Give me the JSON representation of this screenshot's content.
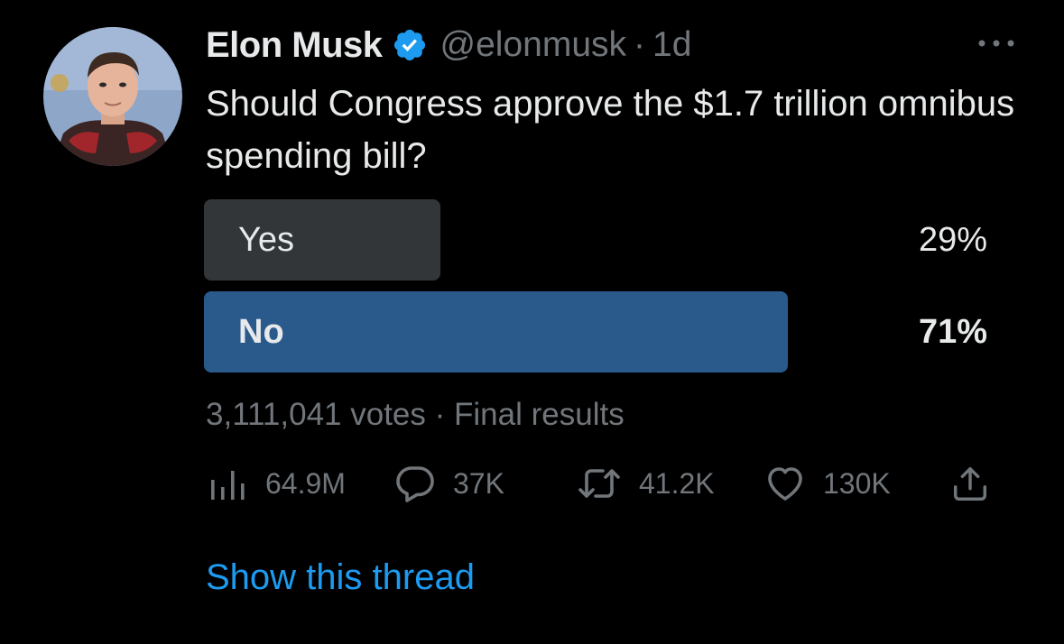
{
  "tweet": {
    "author_name": "Elon Musk",
    "handle": "@elonmusk",
    "separator": "·",
    "time": "1d",
    "verified": true,
    "text": "Should Congress approve the $1.7 trillion omnibus spending bill?"
  },
  "poll": {
    "options": [
      {
        "label": "Yes",
        "percent_text": "29%",
        "fraction": 0.29,
        "winner": false
      },
      {
        "label": "No",
        "percent_text": "71%",
        "fraction": 0.71,
        "winner": true
      }
    ],
    "votes": "3,111,041 votes",
    "separator": "·",
    "status": "Final results"
  },
  "actions": {
    "views": {
      "icon": "analytics-icon",
      "count": "64.9M"
    },
    "replies": {
      "icon": "reply-icon",
      "count": "37K"
    },
    "retweets": {
      "icon": "retweet-icon",
      "count": "41.2K"
    },
    "likes": {
      "icon": "like-icon",
      "count": "130K"
    },
    "share": {
      "icon": "share-icon"
    }
  },
  "show_thread": "Show this thread",
  "colors": {
    "background": "#000000",
    "text": "#e7e9ea",
    "muted": "#71767b",
    "accent": "#1d9bf0",
    "winner_bar": "#2a5a8c",
    "loser_bar": "#333639"
  }
}
